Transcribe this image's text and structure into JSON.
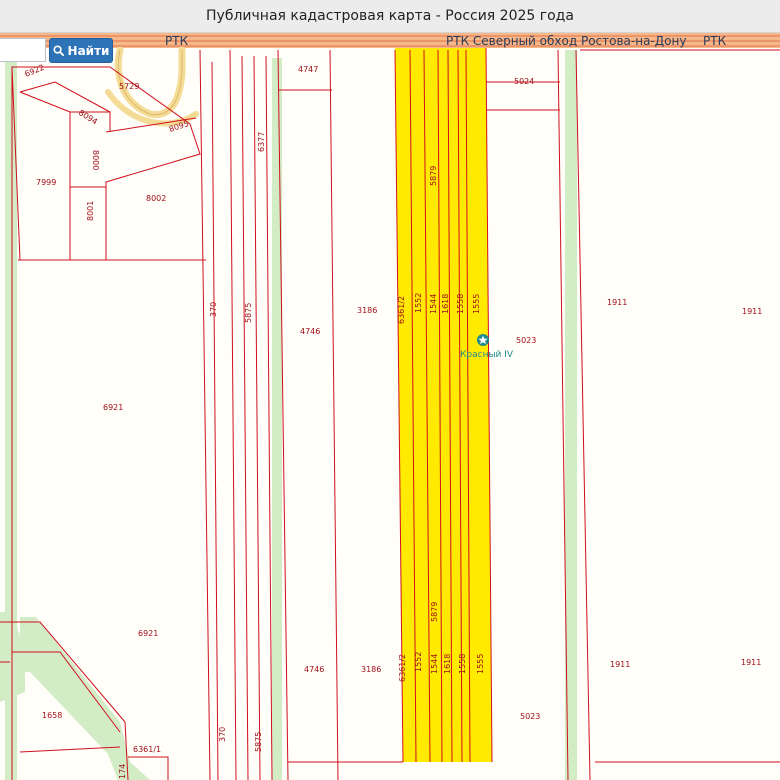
{
  "window": {
    "title": "Публичная кадастровая карта - Россия 2025 года"
  },
  "search": {
    "placeholder": "",
    "button_label": "Найти"
  },
  "roads": {
    "label_left": "РТК",
    "label_main": "РТК  Северный обход Ростова-на-Дону",
    "label_right": "РТК"
  },
  "poi": {
    "name": "Красный IV",
    "icon": "star-marker-icon"
  },
  "parcels": [
    "5729",
    "6922",
    "8094",
    "8095",
    "8000",
    "8001",
    "7999",
    "8002",
    "6377",
    "4747",
    "5024",
    "5879",
    "370",
    "5875",
    "4746",
    "3186",
    "6361/2",
    "1552",
    "1544",
    "1618",
    "1558",
    "1555",
    "5023",
    "1911",
    "6921",
    "1658",
    "6361/1",
    "174"
  ],
  "colors": {
    "boundary": "#d0101e",
    "highlight": "#ffea00",
    "green_strip": "#d2ecc6",
    "road_band": "#f6b888",
    "ring_road": "#f4dc96",
    "button": "#2d73b7",
    "titlebar": "#ececec",
    "background": "#fffef8"
  }
}
